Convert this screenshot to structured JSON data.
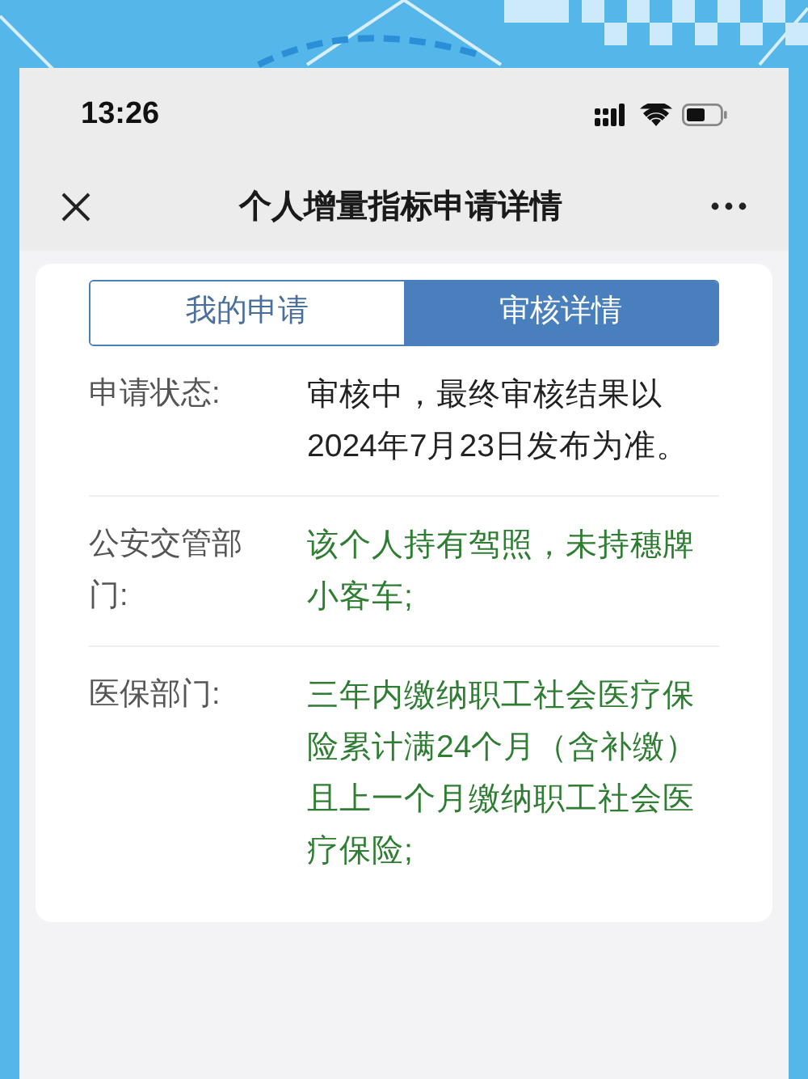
{
  "status_bar": {
    "time": "13:26"
  },
  "nav_bar": {
    "title": "个人增量指标申请详情"
  },
  "tabs": [
    {
      "label": "我的申请",
      "selected": false
    },
    {
      "label": "审核详情",
      "selected": true
    }
  ],
  "rows": [
    {
      "label": "申请状态:",
      "value": "审核中，最终审核结果以2024年7月23日发布为准。",
      "color": "#222222"
    },
    {
      "label": "公安交管部门:",
      "value": "该个人持有驾照，未持穗牌小客车;",
      "color": "#2e7d32"
    },
    {
      "label": "医保部门:",
      "value": "三年内缴纳职工社会医疗保险累计满24个月（含补缴）且上一个月缴纳职工社会医疗保险;",
      "color": "#2e7d32"
    }
  ]
}
